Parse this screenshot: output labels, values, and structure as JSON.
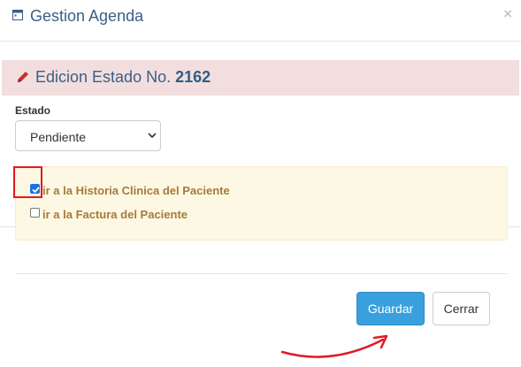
{
  "modal": {
    "title": "Gestion Agenda",
    "close_glyph": "×",
    "header_icon": "window-icon"
  },
  "section": {
    "title_prefix": "Edicion Estado No.",
    "record_number": "2162",
    "icon": "pencil-icon"
  },
  "form": {
    "estado_label": "Estado",
    "estado_selected": "Pendiente"
  },
  "options": [
    {
      "label": "ir a la Historia Clinica del Paciente",
      "checked": true
    },
    {
      "label": "ir a la Factura del Paciente",
      "checked": false
    }
  ],
  "buttons": {
    "save": "Guardar",
    "close": "Cerrar"
  },
  "colors": {
    "title": "#3a5f87",
    "band_bg": "#f2dede",
    "warning_bg": "#fcf8e3",
    "warning_text": "#a57b3b",
    "primary": "#3aa0dd",
    "annotation_red": "#e01b24"
  }
}
